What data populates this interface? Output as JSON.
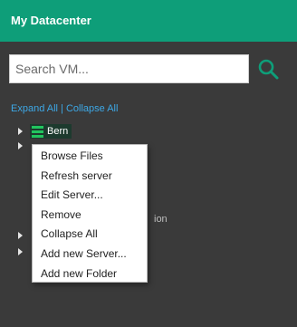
{
  "header": {
    "title": "My Datacenter"
  },
  "search": {
    "placeholder": "Search VM..."
  },
  "tree_actions": {
    "expand_all": "Expand All",
    "separator": "|",
    "collapse_all": "Collapse All"
  },
  "tree": {
    "selected_server": "Bern",
    "partially_hidden_text": "ion"
  },
  "context_menu": {
    "items": [
      "Browse Files",
      "Refresh server",
      "Edit Server...",
      "Remove",
      "Collapse All",
      "Add new Server...",
      "Add new Folder"
    ]
  },
  "colors": {
    "header": "#0e9e79",
    "panel": "#3a3a3a",
    "link": "#3da8e6",
    "server_icon": "#22c55e"
  }
}
